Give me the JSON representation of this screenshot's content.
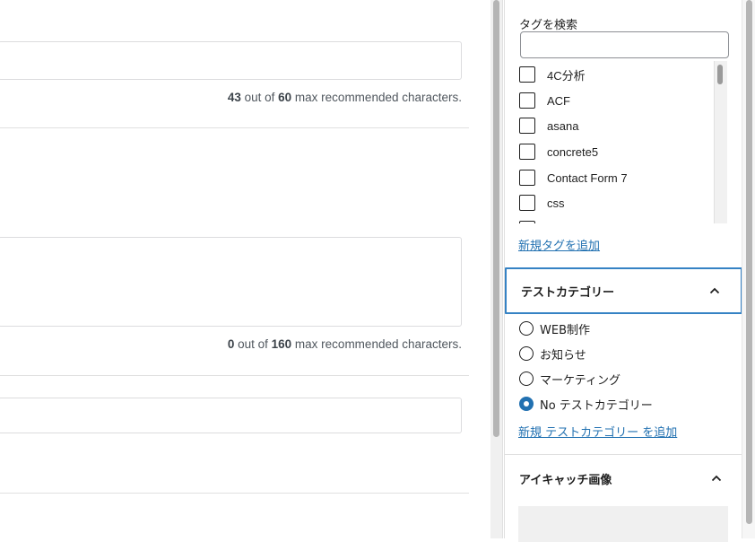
{
  "seo": {
    "title_counter": {
      "count": "43",
      "mid": " out of ",
      "max": "60",
      "suffix": " max recommended characters."
    },
    "desc_counter": {
      "count": "0",
      "mid": " out of ",
      "max": "160",
      "suffix": " max recommended characters."
    }
  },
  "tags": {
    "search_label": "タグを検索",
    "search_value": "",
    "items": [
      {
        "label": "4C分析",
        "checked": false
      },
      {
        "label": "ACF",
        "checked": false
      },
      {
        "label": "asana",
        "checked": false
      },
      {
        "label": "concrete5",
        "checked": false
      },
      {
        "label": "Contact Form 7",
        "checked": false
      },
      {
        "label": "css",
        "checked": false
      }
    ],
    "add_link": "新規タグを追加"
  },
  "test_category": {
    "title": "テストカテゴリー",
    "options": [
      {
        "label": "WEB制作",
        "checked": false
      },
      {
        "label": "お知らせ",
        "checked": false
      },
      {
        "label": "マーケティング",
        "checked": false
      },
      {
        "label": "No テストカテゴリー",
        "checked": true
      }
    ],
    "add_link": "新規 テストカテゴリー を追加"
  },
  "featured_image": {
    "title": "アイキャッチ画像"
  },
  "colors": {
    "accent": "#2271b1",
    "focus_border": "#3582c4"
  }
}
